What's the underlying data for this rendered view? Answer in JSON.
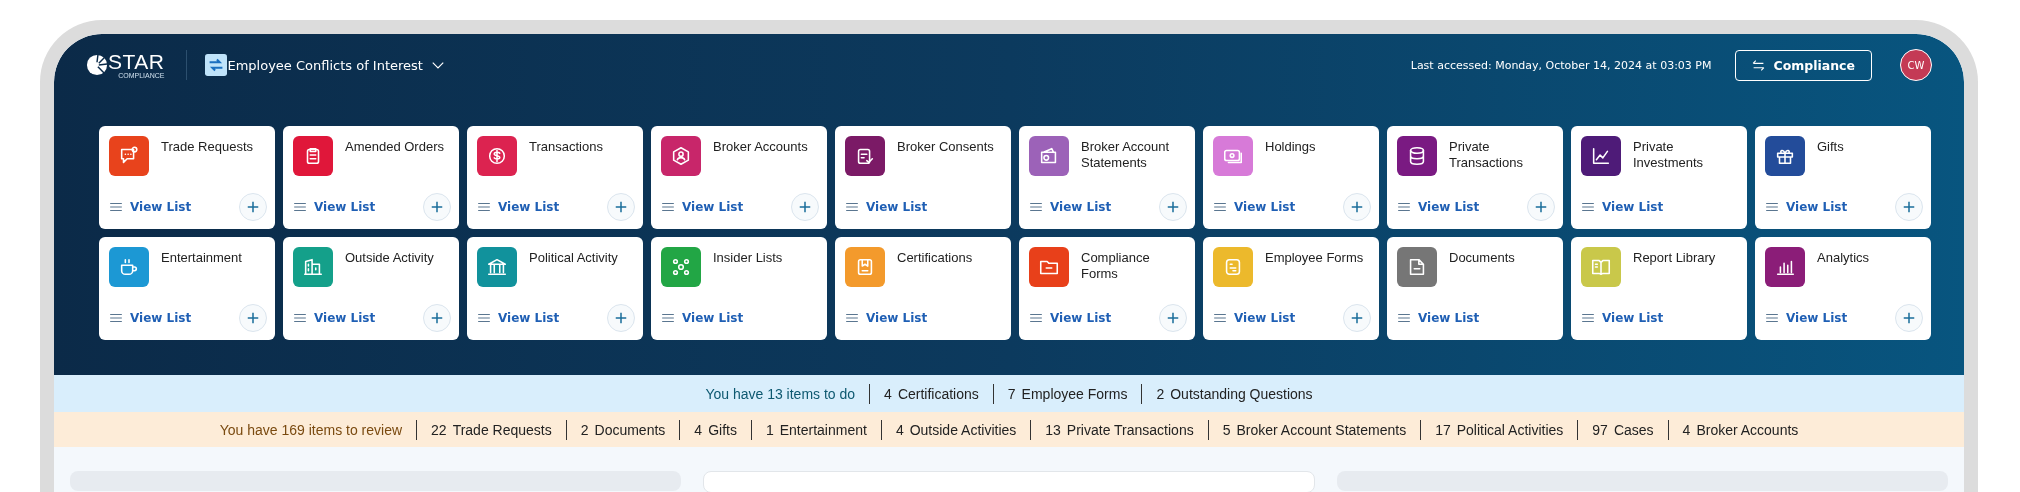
{
  "header": {
    "logo": {
      "name": "STAR",
      "tagline": "COMPLIANCE"
    },
    "app_switcher": {
      "title": "Employee Conflicts of Interest"
    },
    "last_accessed": "Last accessed: Monday, October 14, 2024 at 03:03 PM",
    "role_button": "Compliance",
    "avatar": "CW"
  },
  "modules": [
    {
      "title": "Trade Requests",
      "color": "#e8431c",
      "link": "View List",
      "can_add": true
    },
    {
      "title": "Amended Orders",
      "color": "#e0173a",
      "link": "View List",
      "can_add": true
    },
    {
      "title": "Transactions",
      "color": "#dc2350",
      "link": "View List",
      "can_add": true
    },
    {
      "title": "Broker Accounts",
      "color": "#c8266a",
      "link": "View List",
      "can_add": true
    },
    {
      "title": "Broker Consents",
      "color": "#7b1a66",
      "link": "View List",
      "can_add": false
    },
    {
      "title": "Broker Account Statements",
      "color": "#9c62b8",
      "link": "View List",
      "can_add": true
    },
    {
      "title": "Holdings",
      "color": "#d77ad8",
      "link": "View List",
      "can_add": true
    },
    {
      "title": "Private Transactions",
      "color": "#7a1a82",
      "link": "View List",
      "can_add": true
    },
    {
      "title": "Private Investments",
      "color": "#4e1b78",
      "link": "View List",
      "can_add": false
    },
    {
      "title": "Gifts",
      "color": "#234c9a",
      "link": "View List",
      "can_add": true
    },
    {
      "title": "Entertainment",
      "color": "#1c98d4",
      "link": "View List",
      "can_add": true
    },
    {
      "title": "Outside Activity",
      "color": "#14a08a",
      "link": "View List",
      "can_add": true
    },
    {
      "title": "Political Activity",
      "color": "#11929c",
      "link": "View List",
      "can_add": true
    },
    {
      "title": "Insider Lists",
      "color": "#22a645",
      "link": "View List",
      "can_add": false
    },
    {
      "title": "Certifications",
      "color": "#f39a2c",
      "link": "View List",
      "can_add": false
    },
    {
      "title": "Compliance Forms",
      "color": "#e8401a",
      "link": "View List",
      "can_add": true
    },
    {
      "title": "Employee Forms",
      "color": "#ecb92c",
      "link": "View List",
      "can_add": true
    },
    {
      "title": "Documents",
      "color": "#767676",
      "link": "View List",
      "can_add": false
    },
    {
      "title": "Report Library",
      "color": "#c9c84a",
      "link": "View List",
      "can_add": false
    },
    {
      "title": "Analytics",
      "color": "#8b1d78",
      "link": "View List",
      "can_add": true
    }
  ],
  "todo_bar": {
    "summary": "You have 13 items to do",
    "items": [
      {
        "count": "4",
        "label": "Certifications"
      },
      {
        "count": "7",
        "label": "Employee Forms"
      },
      {
        "count": "2",
        "label": "Outstanding Questions"
      }
    ]
  },
  "review_bar": {
    "summary": "You have 169 items to review",
    "items": [
      {
        "count": "22",
        "label": "Trade Requests"
      },
      {
        "count": "2",
        "label": "Documents"
      },
      {
        "count": "4",
        "label": "Gifts"
      },
      {
        "count": "1",
        "label": "Entertainment"
      },
      {
        "count": "4",
        "label": "Outside Activities"
      },
      {
        "count": "13",
        "label": "Private Transactions"
      },
      {
        "count": "5",
        "label": "Broker Account Statements"
      },
      {
        "count": "17",
        "label": "Political Activities"
      },
      {
        "count": "97",
        "label": "Cases"
      },
      {
        "count": "4",
        "label": "Broker Accounts"
      }
    ]
  }
}
